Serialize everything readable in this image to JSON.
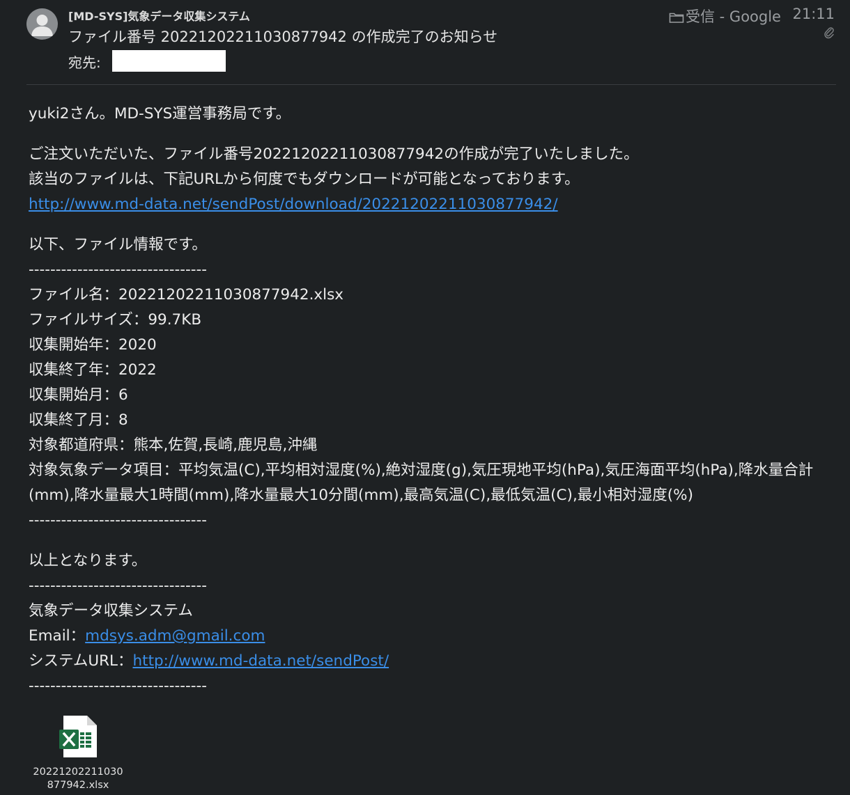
{
  "header": {
    "sender": "[MD-SYS]気象データ収集システム",
    "subject": "ファイル番号 20221202211030877942 の作成完了のお知らせ",
    "to_label": "宛先:",
    "folder": "受信 - Google",
    "time": "21:11"
  },
  "body": {
    "greeting": "yuki2さん。MD-SYS運営事務局です。",
    "p1_line1": "ご注文いただいた、ファイル番号20221202211030877942の作成が完了いたしました。",
    "p1_line2": "該当のファイルは、下記URLから何度でもダウンロードが可能となっております。",
    "download_link": "http://www.md-data.net/sendPost/download/20221202211030877942/",
    "info_intro": "以下、ファイル情報です。",
    "separator": "---------------------------------",
    "file_name": "ファイル名：20221202211030877942.xlsx",
    "file_size": "ファイルサイズ：99.7KB",
    "start_year": "収集開始年：2020",
    "end_year": "収集終了年：2022",
    "start_month": "収集開始月：6",
    "end_month": "収集終了月：8",
    "prefectures": "対象都道府県：熊本,佐賀,長崎,鹿児島,沖縄",
    "items": "対象気象データ項目：平均気温(C),平均相対湿度(%),絶対湿度(g),気圧現地平均(hPa),気圧海面平均(hPa),降水量合計(mm),降水量最大1時間(mm),降水量最大10分間(mm),最高気温(C),最低気温(C),最小相対湿度(%)",
    "closing": "以上となります。",
    "signature_name": "気象データ収集システム",
    "email_label": "Email：",
    "email": "mdsys.adm@gmail.com",
    "system_url_label": "システムURL：",
    "system_url": "http://www.md-data.net/sendPost/"
  },
  "attachment": {
    "name": "20221202211030877942.xlsx",
    "icon": "excel-file-icon"
  },
  "colors": {
    "background": "#1e2123",
    "link": "#3a8ee8",
    "excel_green": "#1d6f42"
  }
}
